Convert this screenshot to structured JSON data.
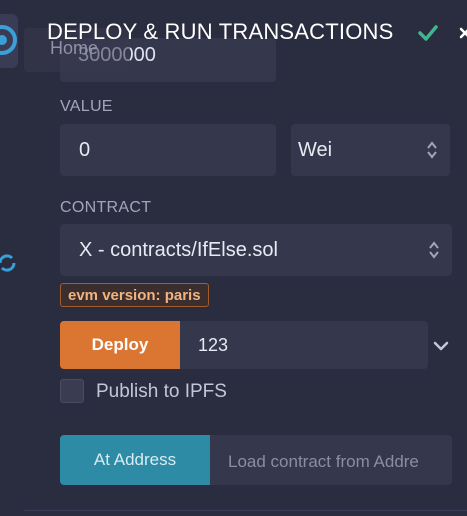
{
  "header": {
    "title": "DEPLOY & RUN TRANSACTIONS"
  },
  "home_tab": {
    "label": "Home"
  },
  "gas_limit": {
    "value": "3000000"
  },
  "value_section": {
    "label": "VALUE",
    "amount": "0",
    "unit": "Wei"
  },
  "contract_section": {
    "label": "CONTRACT",
    "selected": "X - contracts/IfElse.sol"
  },
  "evm_badge": {
    "text": "evm version: paris"
  },
  "deploy": {
    "button_label": "Deploy",
    "args_value": "123"
  },
  "publish": {
    "label": "Publish to IPFS",
    "checked": false
  },
  "at_address": {
    "button_label": "At Address",
    "placeholder": "Load contract from Addre"
  },
  "colors": {
    "background": "#222336",
    "panel": "#2a2c3f",
    "input": "#35374c",
    "deploy_accent": "#db7632",
    "at_address_accent": "#2d8ba6",
    "check_accent": "#3fb68b",
    "badge_text": "#f3b27e"
  },
  "icons": [
    "remix-logo-icon",
    "refresh-icon",
    "check-icon",
    "close-icon",
    "select-arrows-icon",
    "chevron-down-icon"
  ]
}
